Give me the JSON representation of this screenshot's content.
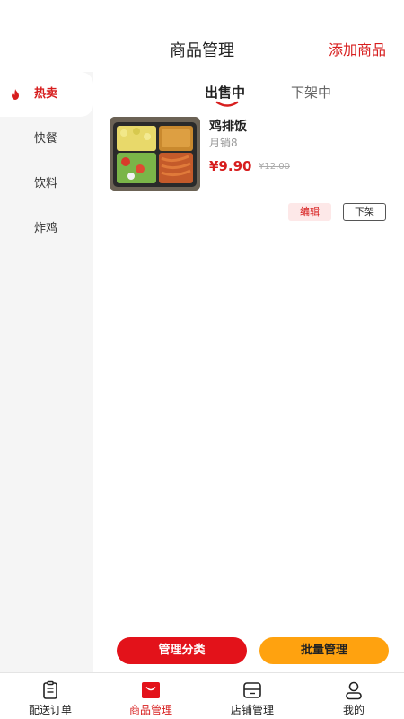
{
  "header": {
    "title": "商品管理",
    "add_label": "添加商品"
  },
  "sidebar": {
    "items": [
      {
        "label": "热卖",
        "active": true,
        "icon": "fire-icon"
      },
      {
        "label": "快餐"
      },
      {
        "label": "饮料"
      },
      {
        "label": "炸鸡"
      }
    ]
  },
  "tabs": {
    "on_sale": "出售中",
    "off_shelf": "下架中"
  },
  "products": [
    {
      "name": "鸡排饭",
      "sales": "月销8",
      "price": "¥9.90",
      "original_price": "¥12.00",
      "edit_label": "编辑",
      "offshelf_label": "下架"
    }
  ],
  "actions": {
    "manage_category": "管理分类",
    "batch_manage": "批量管理"
  },
  "bottom_nav": {
    "items": [
      {
        "label": "配送订单",
        "icon": "clipboard-icon"
      },
      {
        "label": "商品管理",
        "icon": "shopping-bag-icon",
        "active": true
      },
      {
        "label": "店铺管理",
        "icon": "store-icon"
      },
      {
        "label": "我的",
        "icon": "user-icon"
      }
    ]
  },
  "colors": {
    "accent": "#d71e1e",
    "orange": "#ffa20f",
    "sidebar_bg": "#f5f5f5"
  }
}
